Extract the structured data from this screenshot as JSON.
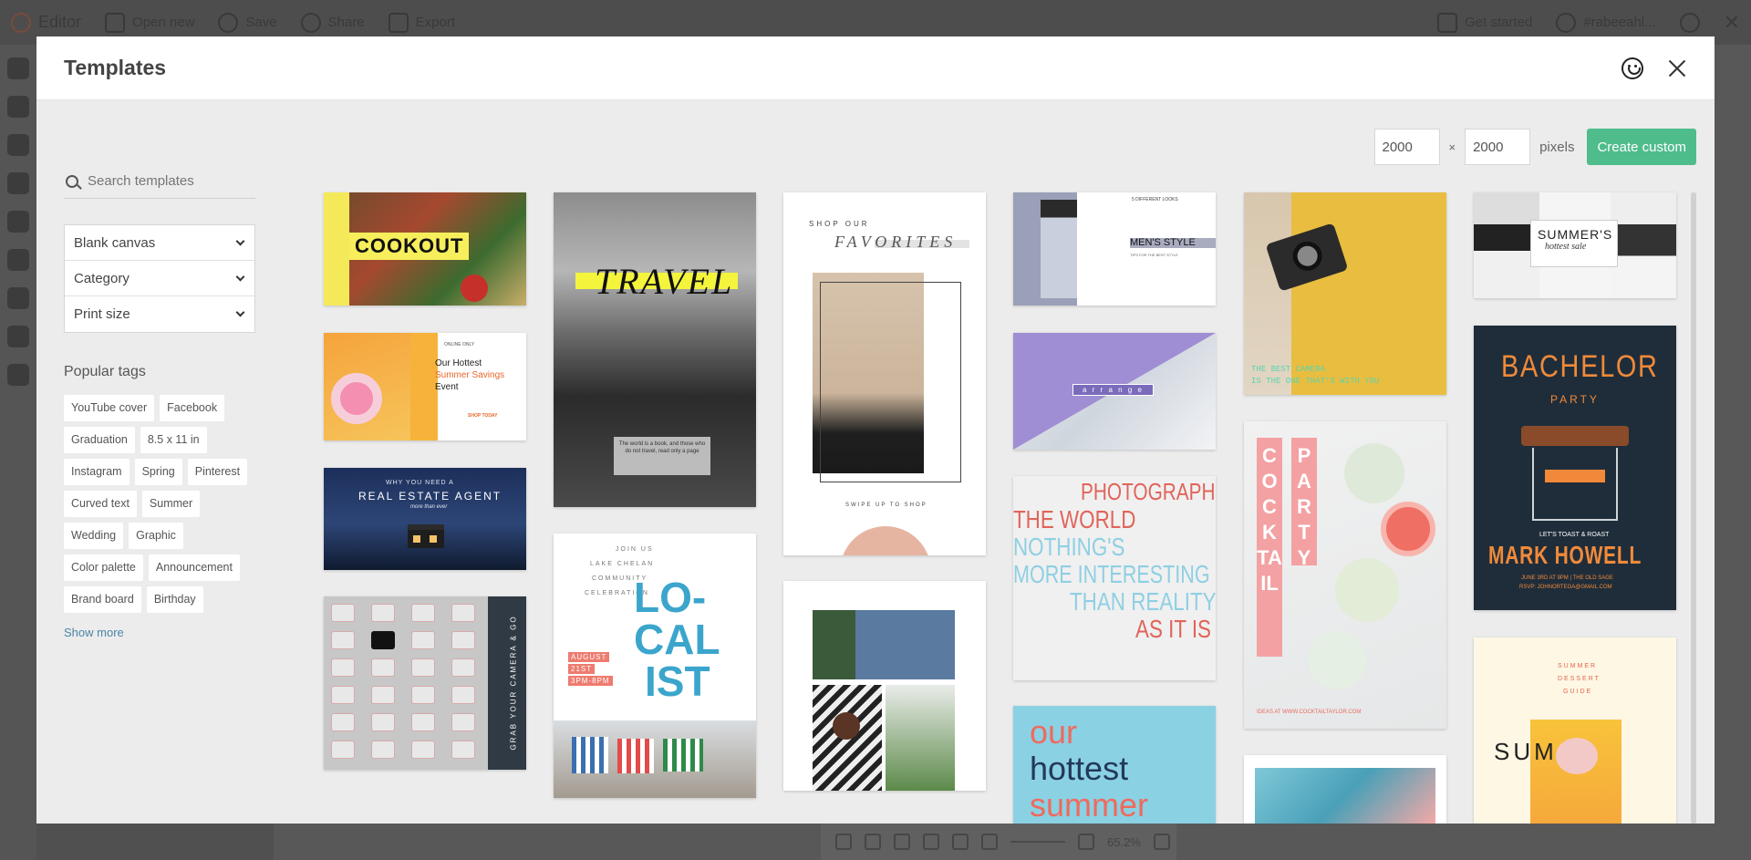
{
  "editor": {
    "app_title": "Editor",
    "open_new": "Open new",
    "save": "Save",
    "share": "Share",
    "export": "Export",
    "get_started": "Get started",
    "username": "#rabeeahl..."
  },
  "modal": {
    "title": "Templates",
    "search_placeholder": "Search templates",
    "selects": [
      "Blank canvas",
      "Category",
      "Print size"
    ],
    "popular_tags_title": "Popular tags",
    "tags": [
      "YouTube cover",
      "Facebook",
      "Graduation",
      "8.5 x 11 in",
      "Instagram",
      "Spring",
      "Pinterest",
      "Curved text",
      "Summer",
      "Wedding",
      "Graphic",
      "Color palette",
      "Announcement",
      "Brand board",
      "Birthday"
    ],
    "show_more": "Show more",
    "width_value": "2000",
    "height_value": "2000",
    "times": "×",
    "pixels": "pixels",
    "create_custom": "Create custom"
  },
  "templates": {
    "cookout": {
      "headline": "COOKOUT"
    },
    "travel": {
      "headline": "TRAVEL",
      "caption": "The world is a book, and those who do not travel, read only a page"
    },
    "favorites": {
      "line1": "SHOP OUR",
      "line2": "FAVORITES",
      "footer": "SWIPE UP TO SHOP"
    },
    "mens_style": {
      "label": "5 DIFFERENT LOOKS",
      "headline": "MEN'S STYLE",
      "sub": "TIPS FOR THE BEST STYLE"
    },
    "camera": {
      "caption_1": "THE BEST CAMERA",
      "caption_2": "IS THE ONE THAT'S WITH YOU"
    },
    "summers_sale": {
      "headline": "SUMMER'S",
      "sub": "hottest sale"
    },
    "summer_savings": {
      "kicker": "ONLINE ONLY",
      "line1": "Our Hottest",
      "line2": "Summer Savings",
      "line3": "Event",
      "cta": "SHOP TODAY"
    },
    "arrange": {
      "label": "a r r a n g e"
    },
    "bachelor": {
      "line1": "BACHELOR",
      "line2": "PARTY",
      "line3": "LET'S TOAST & ROAST",
      "name": "MARK HOWELL",
      "details": "JUNE 3RD AT 9PM | THE OLD SAGE",
      "rsvp": "RSVP: JOHNORTEGA@GMAIL.COM"
    },
    "real_estate": {
      "kicker": "WHY YOU NEED A",
      "headline": "REAL ESTATE AGENT",
      "sub": "more than ever"
    },
    "localist": {
      "lines": [
        "JOIN US",
        "LAKE CHELAN",
        "COMMUNITY",
        "CELEBRATION"
      ],
      "big": [
        "LO-",
        "CAL",
        "IST"
      ],
      "date": [
        "AUGUST",
        "21ST",
        "3PM-8PM"
      ]
    },
    "photograph": {
      "lines": [
        "PHOTOGRAPH",
        "THE WORLD",
        "NOTHING'S",
        "MORE INTERESTING",
        "THAN REALITY",
        "AS IT IS"
      ]
    },
    "cocktail": {
      "word1": "COCKTAIL",
      "word2": "PARTY",
      "footer": "IDEAS AT WWW.COCKTAILTAYLOR.COM"
    },
    "grab_camera": {
      "vertical": "GRAB YOUR CAMERA & GO"
    },
    "our_hottest": {
      "lines": [
        "our",
        "hottest",
        "summer"
      ]
    },
    "dessert": {
      "lines": [
        "SUMMER",
        "DESSERT",
        "GUIDE"
      ],
      "big": "SUM"
    }
  },
  "bottom_toolbar": {
    "zoom": "65.2%"
  }
}
